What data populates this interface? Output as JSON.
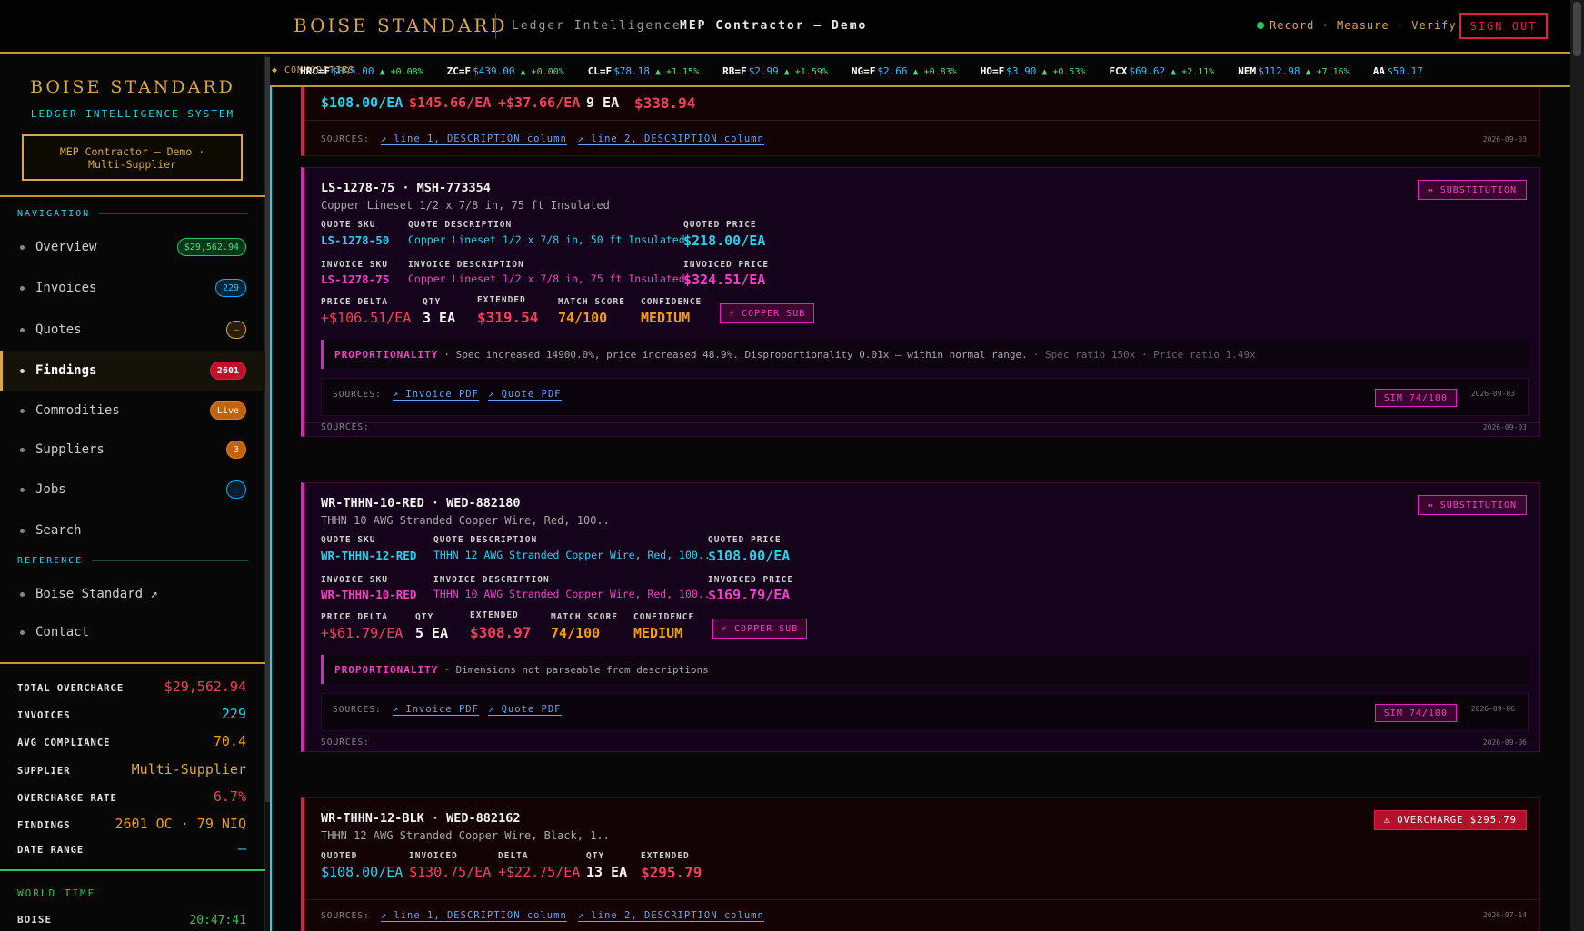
{
  "header": {
    "brand": "BOISE STANDARD",
    "subtitle": "Ledger Intelligence",
    "client": "MEP Contractor — Demo",
    "status": "Record · Measure · Verify",
    "signout": "SIGN OUT"
  },
  "sidebar": {
    "brand": "BOISE STANDARD",
    "subtitle": "LEDGER INTELLIGENCE SYSTEM",
    "client_line1": "MEP Contractor — Demo ·",
    "client_line2": "Multi-Supplier",
    "nav_heading": "NAVIGATION",
    "items": [
      {
        "label": "Overview",
        "badge": "$29,562.94"
      },
      {
        "label": "Invoices",
        "badge": "229"
      },
      {
        "label": "Quotes",
        "badge": "—"
      },
      {
        "label": "Findings",
        "badge": "2601"
      },
      {
        "label": "Commodities",
        "badge": "Live"
      },
      {
        "label": "Suppliers",
        "badge": "3"
      },
      {
        "label": "Jobs",
        "badge": "—"
      },
      {
        "label": "Search",
        "badge": ""
      }
    ],
    "ref_heading": "REFERENCE",
    "ref_items": [
      {
        "label": "Boise Standard ↗"
      },
      {
        "label": "Contact"
      }
    ],
    "stats": [
      {
        "key": "TOTAL OVERCHARGE",
        "value": "$29,562.94",
        "color": "#f43f5e"
      },
      {
        "key": "INVOICES",
        "value": "229",
        "color": "#22d3ee"
      },
      {
        "key": "AVG COMPLIANCE",
        "value": "70.4",
        "color": "#f59e0b"
      },
      {
        "key": "SUPPLIER",
        "value": "Multi-Supplier",
        "color": "#d9a648"
      },
      {
        "key": "OVERCHARGE RATE",
        "value": "6.7%",
        "color": "#f43f5e"
      },
      {
        "key": "FINDINGS",
        "value": "2601 OC · 79 NIQ",
        "color": "#f59e0b"
      },
      {
        "key": "DATE RANGE",
        "value": "—",
        "color": "#22d3ee"
      }
    ],
    "world_time_heading": "WORLD TIME",
    "world_time": {
      "city": "BOISE",
      "time": "20:47:41"
    }
  },
  "ticker": {
    "label": "◆ COMMODITIES",
    "items": [
      {
        "sym": "HRC=F",
        "price": "$895.00",
        "chg": "▲ +0.08%"
      },
      {
        "sym": "ZC=F",
        "price": "$439.00",
        "chg": "▲ +0.00%"
      },
      {
        "sym": "CL=F",
        "price": "$78.18",
        "chg": "▲ +1.15%"
      },
      {
        "sym": "RB=F",
        "price": "$2.99",
        "chg": "▲ +1.59%"
      },
      {
        "sym": "NG=F",
        "price": "$2.66",
        "chg": "▲ +0.83%"
      },
      {
        "sym": "HO=F",
        "price": "$3.90",
        "chg": "▲ +0.53%"
      },
      {
        "sym": "FCX",
        "price": "$69.62",
        "chg": "▲ +2.11%"
      },
      {
        "sym": "NEM",
        "price": "$112.98",
        "chg": "▲ +7.16%"
      },
      {
        "sym": "AA",
        "price": "$50.17",
        "chg": ""
      }
    ]
  },
  "cards": {
    "c0": {
      "quoted": "$108.00/EA",
      "invoiced": "$145.66/EA",
      "delta": "+$37.66/EA",
      "qty": "9 EA",
      "extended": "$338.94",
      "sources_label": "SOURCES:",
      "link1": "↗ line 1, DESCRIPTION column",
      "link2": "↗ line 2, DESCRIPTION column",
      "date": "2026-09-03"
    },
    "c1": {
      "title": "LS-1278-75 · MSH-773354",
      "desc": "Copper Lineset 1/2 x 7/8 in, 75 ft Insulated",
      "tag": "↔ SUBSTITUTION",
      "l_quote_sku": "QUOTE SKU",
      "quote_sku": "LS-1278-50",
      "l_quote_desc": "QUOTE DESCRIPTION",
      "quote_desc": "Copper Lineset 1/2 x 7/8 in, 50 ft Insulated",
      "l_quoted_price": "QUOTED PRICE",
      "quoted_price": "$218.00/EA",
      "l_inv_sku": "INVOICE SKU",
      "inv_sku": "LS-1278-75",
      "l_inv_desc": "INVOICE DESCRIPTION",
      "inv_desc": "Copper Lineset 1/2 x 7/8 in, 75 ft Insulated",
      "l_inv_price": "INVOICED PRICE",
      "inv_price": "$324.51/EA",
      "l_delta": "PRICE DELTA",
      "delta": "+$106.51/EA",
      "l_qty": "QTY",
      "qty": "3 EA",
      "l_ext": "EXTENDED",
      "ext": "$319.54",
      "l_match": "MATCH SCORE",
      "match": "74/100",
      "l_conf": "CONFIDENCE",
      "conf": "MEDIUM",
      "copper": "⚡ COPPER SUB",
      "prop_label": "PROPORTIONALITY",
      "prop_text": "· Spec increased 14900.0%, price increased 48.9%. Disproportionality 0.01x — within normal range.",
      "prop_meta": "· Spec ratio 150x · Price ratio 1.49x",
      "inner_sources": "SOURCES:",
      "inv_pdf": "↗ Invoice PDF",
      "quote_pdf": "↗ Quote PDF",
      "sim": "SIM 74/100",
      "inner_date": "2026-09-03",
      "outer_sources": "SOURCES:",
      "outer_date": "2026-09-03"
    },
    "c2": {
      "title": "WR-THHN-10-RED · WED-882180",
      "desc": "THHN 10 AWG Stranded Copper Wire, Red, 100..",
      "tag": "↔ SUBSTITUTION",
      "l_quote_sku": "QUOTE SKU",
      "quote_sku": "WR-THHN-12-RED",
      "l_quote_desc": "QUOTE DESCRIPTION",
      "quote_desc": "THHN 12 AWG Stranded Copper Wire, Red, 100..",
      "l_quoted_price": "QUOTED PRICE",
      "quoted_price": "$108.00/EA",
      "l_inv_sku": "INVOICE SKU",
      "inv_sku": "WR-THHN-10-RED",
      "l_inv_desc": "INVOICE DESCRIPTION",
      "inv_desc": "THHN 10 AWG Stranded Copper Wire, Red, 100..",
      "l_inv_price": "INVOICED PRICE",
      "inv_price": "$169.79/EA",
      "l_delta": "PRICE DELTA",
      "delta": "+$61.79/EA",
      "l_qty": "QTY",
      "qty": "5 EA",
      "l_ext": "EXTENDED",
      "ext": "$308.97",
      "l_match": "MATCH SCORE",
      "match": "74/100",
      "l_conf": "CONFIDENCE",
      "conf": "MEDIUM",
      "copper": "⚡ COPPER SUB",
      "prop_label": "PROPORTIONALITY",
      "prop_text": "· Dimensions not parseable from descriptions",
      "inner_sources": "SOURCES:",
      "inv_pdf": "↗ Invoice PDF",
      "quote_pdf": "↗ Quote PDF",
      "sim": "SIM 74/100",
      "inner_date": "2026-09-06",
      "outer_sources": "SOURCES:",
      "outer_date": "2026-09-06"
    },
    "c3": {
      "title": "WR-THHN-12-BLK · WED-882162",
      "desc": "THHN 12 AWG Stranded Copper Wire, Black, 1..",
      "tag": "⚠ OVERCHARGE $295.79",
      "l_quoted": "QUOTED",
      "quoted": "$108.00/EA",
      "l_invoiced": "INVOICED",
      "invoiced": "$130.75/EA",
      "l_delta": "DELTA",
      "delta": "+$22.75/EA",
      "l_qty": "QTY",
      "qty": "13 EA",
      "l_ext": "EXTENDED",
      "ext": "$295.79",
      "sources_label": "SOURCES:",
      "link1": "↗ line 1, DESCRIPTION column",
      "link2": "↗ line 2, DESCRIPTION column",
      "date": "2026-07-14"
    }
  }
}
